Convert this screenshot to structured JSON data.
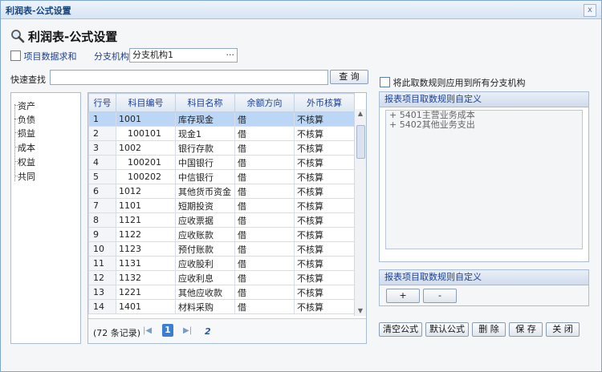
{
  "window": {
    "title": "利润表-公式设置",
    "close": "x"
  },
  "heading": {
    "text": "利润表-公式设置",
    "icon": "search-icon"
  },
  "options": {
    "sum_project_data": "项目数据求和",
    "branch_label": "分支机构",
    "branch_value": "分支机构1",
    "branch_browse": "···"
  },
  "quick_search": {
    "label": "快速查找",
    "value": "",
    "button": "查 询"
  },
  "apply_all": "将此取数规则应用到所有分支机构",
  "tree": [
    "资产",
    "负债",
    "损益",
    "成本",
    "权益",
    "共同"
  ],
  "table": {
    "headers": [
      "行号",
      "科目编号",
      "科目名称",
      "余额方向",
      "外币核算"
    ],
    "rows": [
      [
        "1",
        "1001",
        "库存现金",
        "借",
        "不核算"
      ],
      [
        "2",
        "100101",
        "现金1",
        "借",
        "不核算"
      ],
      [
        "3",
        "1002",
        "银行存款",
        "借",
        "不核算"
      ],
      [
        "4",
        "100201",
        "中国银行",
        "借",
        "不核算"
      ],
      [
        "5",
        "100202",
        "中信银行",
        "借",
        "不核算"
      ],
      [
        "6",
        "1012",
        "其他货币资金",
        "借",
        "不核算"
      ],
      [
        "7",
        "1101",
        "短期投资",
        "借",
        "不核算"
      ],
      [
        "8",
        "1121",
        "应收票据",
        "借",
        "不核算"
      ],
      [
        "9",
        "1122",
        "应收账款",
        "借",
        "不核算"
      ],
      [
        "10",
        "1123",
        "预付账款",
        "借",
        "不核算"
      ],
      [
        "11",
        "1131",
        "应收股利",
        "借",
        "不核算"
      ],
      [
        "12",
        "1132",
        "应收利息",
        "借",
        "不核算"
      ],
      [
        "13",
        "1221",
        "其他应收款",
        "借",
        "不核算"
      ],
      [
        "14",
        "1401",
        "材料采购",
        "借",
        "不核算"
      ]
    ],
    "selected_row": 0,
    "indented_codes": [
      "100101",
      "100201",
      "100202"
    ]
  },
  "pager": {
    "count": "(72 条记录)",
    "page1": "1",
    "page2": "2"
  },
  "rule_panel": {
    "title": "报表项目取数规则自定义",
    "items": [
      "+ 5401主营业务成本",
      "+ 5402其他业务支出"
    ]
  },
  "rule_panel2": {
    "title": "报表项目取数规则自定义",
    "add": "+",
    "remove": "-"
  },
  "actions": {
    "clear": "清空公式",
    "default": "默认公式",
    "delete": "删 除",
    "save": "保 存",
    "close": "关 闭"
  }
}
